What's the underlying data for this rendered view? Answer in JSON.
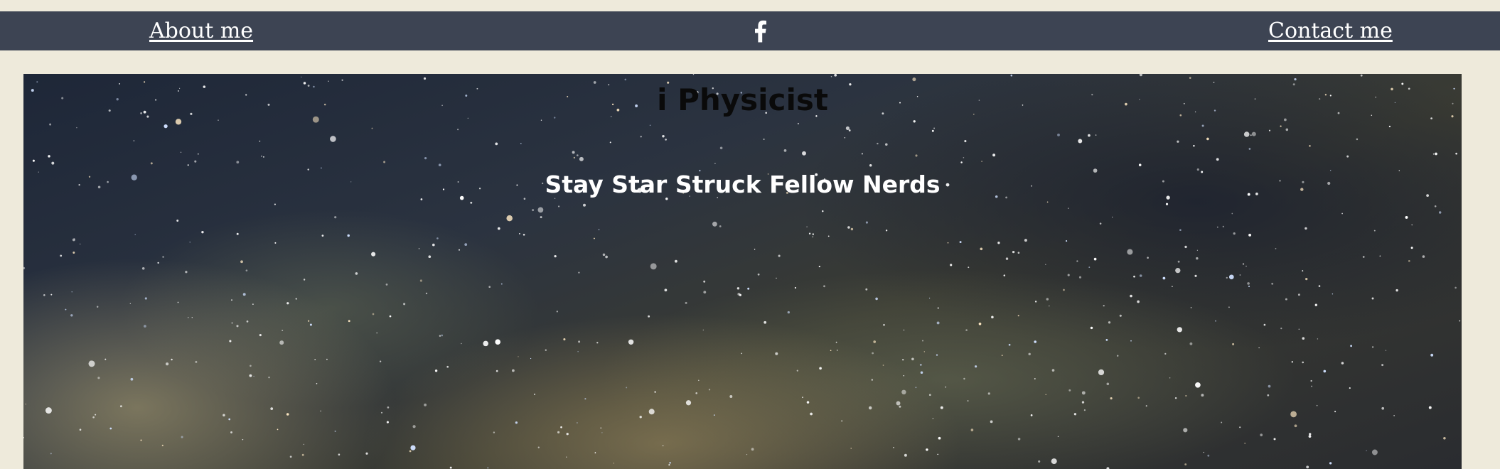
{
  "nav": {
    "about_label": "About me",
    "contact_label": "Contact me",
    "social_icon": "facebook-icon",
    "bg_color": "#3d4453",
    "text_color": "#ffffff"
  },
  "hero": {
    "title": "i Physicist",
    "subtitle": "Stay Star Struck Fellow Nerds",
    "background": "starry-night-milky-way-image"
  },
  "page": {
    "bg_color": "#eeeadb"
  }
}
